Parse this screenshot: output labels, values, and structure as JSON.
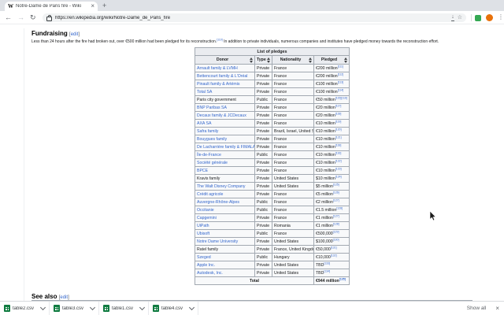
{
  "browser": {
    "tab_title": "Notre-Dame de Paris fire - Wiki",
    "url": "https://en.wikipedia.org/wiki/Notre-Dame_de_Paris_fire",
    "glyphs": {
      "back": "←",
      "forward": "→",
      "reload": "↻",
      "download_indicator": "↓",
      "bookmark_star": "☆",
      "menu_dots": "⋮",
      "new_tab": "+",
      "tab_close": "×",
      "favicon_letter": "W"
    },
    "colors": {
      "avatar": "#e8710a",
      "extension": "#34a853",
      "link_blue": "#3366cc"
    }
  },
  "article": {
    "heading": "Fundraising",
    "edit_open": "[",
    "edit_label": "edit",
    "edit_close": "]",
    "intro": {
      "before_ref": "Less than 24 hours after the fire had broken out, over €500 million had been pledged for its reconstruction.",
      "ref": "[110]",
      "after_ref": " In addition to private individuals, numerous companies and institutes have pledged money towards the reconstruction effort."
    },
    "see_also_heading": "See also",
    "table": {
      "caption": "List of pledges",
      "columns": [
        "Donor",
        "Type",
        "Nationality",
        "Pledged"
      ],
      "rows": [
        {
          "donor": "Arnault family & LVMH",
          "link": true,
          "type": "Private",
          "nationality": "France",
          "pledged": "€200 million",
          "refs": "[111]"
        },
        {
          "donor": "Bettencourt family & L'Oréal",
          "link": true,
          "type": "Private",
          "nationality": "France",
          "pledged": "€200 million",
          "refs": "[112]"
        },
        {
          "donor": "Pinault family & Artémis",
          "link": true,
          "type": "Private",
          "nationality": "France",
          "pledged": "€100 million",
          "refs": "[113]"
        },
        {
          "donor": "Total SA",
          "link": true,
          "type": "Private",
          "nationality": "France",
          "pledged": "€100 million",
          "refs": "[114]"
        },
        {
          "donor": "Paris city government",
          "link": false,
          "type": "Public",
          "nationality": "France",
          "pledged": "€50 million",
          "refs": "[115][116]"
        },
        {
          "donor": "BNP Paribas SA",
          "link": true,
          "type": "Private",
          "nationality": "France",
          "pledged": "€20 million",
          "refs": "[117]"
        },
        {
          "donor": "Decaux family & JCDecaux",
          "link": true,
          "type": "Private",
          "nationality": "France",
          "pledged": "€20 million",
          "refs": "[118]"
        },
        {
          "donor": "AXA SA",
          "link": true,
          "type": "Private",
          "nationality": "France",
          "pledged": "€10 million",
          "refs": "[119]"
        },
        {
          "donor": "Safra family",
          "link": true,
          "type": "Private",
          "nationality": "Brazil, Israel, United States",
          "pledged": "€10 million",
          "refs": "[120]"
        },
        {
          "donor": "Bouygues family",
          "link": true,
          "type": "Private",
          "nationality": "France",
          "pledged": "€10 million",
          "refs": "[121]"
        },
        {
          "donor": "De Lacharrière family & FIMALAC",
          "link": true,
          "type": "Private",
          "nationality": "France",
          "pledged": "€10 million",
          "refs": "[118]"
        },
        {
          "donor": "Île-de-France",
          "link": true,
          "type": "Public",
          "nationality": "France",
          "pledged": "€10 million",
          "refs": "[116]"
        },
        {
          "donor": "Société générale",
          "link": true,
          "type": "Private",
          "nationality": "France",
          "pledged": "€10 million",
          "refs": "[122]"
        },
        {
          "donor": "BPCE",
          "link": true,
          "type": "Private",
          "nationality": "France",
          "pledged": "€10 million",
          "refs": "[123]"
        },
        {
          "donor": "Kravis family",
          "link": false,
          "type": "Private",
          "nationality": "United States",
          "pledged": "$10 million",
          "refs": "[124]"
        },
        {
          "donor": "The Walt Disney Company",
          "link": true,
          "type": "Private",
          "nationality": "United States",
          "pledged": "$5 million",
          "refs": "[125]"
        },
        {
          "donor": "Crédit agricole",
          "link": true,
          "type": "Private",
          "nationality": "France",
          "pledged": "€5 million",
          "refs": "[126]"
        },
        {
          "donor": "Auvergne-Rhône-Alpes",
          "link": true,
          "type": "Public",
          "nationality": "France",
          "pledged": "€2 million",
          "refs": "[127]"
        },
        {
          "donor": "Occitanie",
          "link": true,
          "type": "Public",
          "nationality": "France",
          "pledged": "€1.5 million",
          "refs": "[128]"
        },
        {
          "donor": "Capgemini",
          "link": true,
          "type": "Private",
          "nationality": "France",
          "pledged": "€1 million",
          "refs": "[127]"
        },
        {
          "donor": "UiPath",
          "link": true,
          "type": "Private",
          "nationality": "Romania",
          "pledged": "€1 million",
          "refs": "[128]"
        },
        {
          "donor": "Ubisoft",
          "link": true,
          "type": "Public",
          "nationality": "France",
          "pledged": "€500,000",
          "refs": "[129]"
        },
        {
          "donor": "Notre Dame University",
          "link": true,
          "type": "Private",
          "nationality": "United States",
          "pledged": "$100,000",
          "refs": "[130]"
        },
        {
          "donor": "Ratel family",
          "link": false,
          "type": "Private",
          "nationality": "France, United Kingdom",
          "pledged": "€50,000",
          "refs": "[131]"
        },
        {
          "donor": "Szeged",
          "link": true,
          "type": "Public",
          "nationality": "Hungary",
          "pledged": "€10,000",
          "refs": "[132]"
        },
        {
          "donor": "Apple Inc.",
          "link": true,
          "type": "Private",
          "nationality": "United States",
          "pledged": "TBD",
          "refs": "[133]"
        },
        {
          "donor": "Autodesk, Inc.",
          "link": true,
          "type": "Private",
          "nationality": "United States",
          "pledged": "TBD",
          "refs": "[134]"
        }
      ],
      "total_label": "Total",
      "total_value": "€944 million",
      "total_refs": "[135]"
    }
  },
  "downloads": {
    "items": [
      {
        "name": "table2.csv"
      },
      {
        "name": "table3.csv"
      },
      {
        "name": "table1.csv"
      },
      {
        "name": "table4.csv"
      }
    ],
    "show_all_label": "Show all",
    "close_label": "×"
  }
}
